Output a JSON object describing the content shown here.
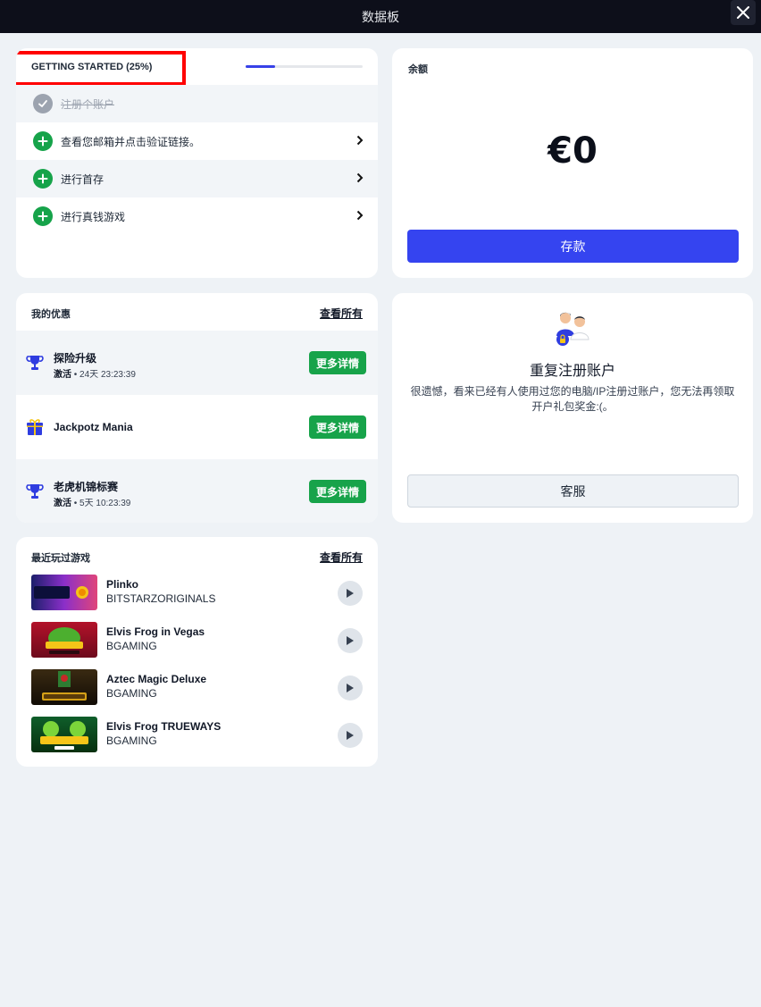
{
  "topbar": {
    "title": "数据板"
  },
  "getting_started": {
    "title": "GETTING STARTED (25%)",
    "progress_percent": 25,
    "steps": [
      {
        "label": "注册个账户",
        "done": true
      },
      {
        "label": "查看您邮箱并点击验证链接。",
        "done": false
      },
      {
        "label": "进行首存",
        "done": false
      },
      {
        "label": "进行真钱游戏",
        "done": false
      }
    ]
  },
  "balance": {
    "label": "余额",
    "amount": "€0",
    "deposit_label": "存款"
  },
  "offers": {
    "title": "我的优惠",
    "view_all": "查看所有",
    "items": [
      {
        "name": "探险升级",
        "status": "激活",
        "time": " • 24天 23:23:39",
        "button": "更多详情",
        "icon": "trophy-icon"
      },
      {
        "name": "Jackpotz Mania",
        "status": "",
        "time": "",
        "button": "更多详情",
        "icon": "gift-icon"
      },
      {
        "name": "老虎机锦标赛",
        "status": "激活",
        "time": " • 5天 10:23:39",
        "button": "更多详情",
        "icon": "trophy-icon"
      }
    ]
  },
  "duplicate": {
    "title": "重复注册账户",
    "description": "很遗憾，看来已经有人使用过您的电脑/IP注册过账户，您无法再领取开户礼包奖金:(。",
    "support_label": "客服"
  },
  "recent_games": {
    "title": "最近玩过游戏",
    "view_all": "查看所有",
    "items": [
      {
        "name": "Plinko",
        "provider": "BITSTARZORIGINALS"
      },
      {
        "name": "Elvis Frog in Vegas",
        "provider": "BGAMING"
      },
      {
        "name": "Aztec Magic Deluxe",
        "provider": "BGAMING"
      },
      {
        "name": "Elvis Frog TRUEWAYS",
        "provider": "BGAMING"
      }
    ]
  },
  "colors": {
    "accent_blue": "#3544f0",
    "success_green": "#17a34a",
    "highlight_red": "#ff0000"
  }
}
